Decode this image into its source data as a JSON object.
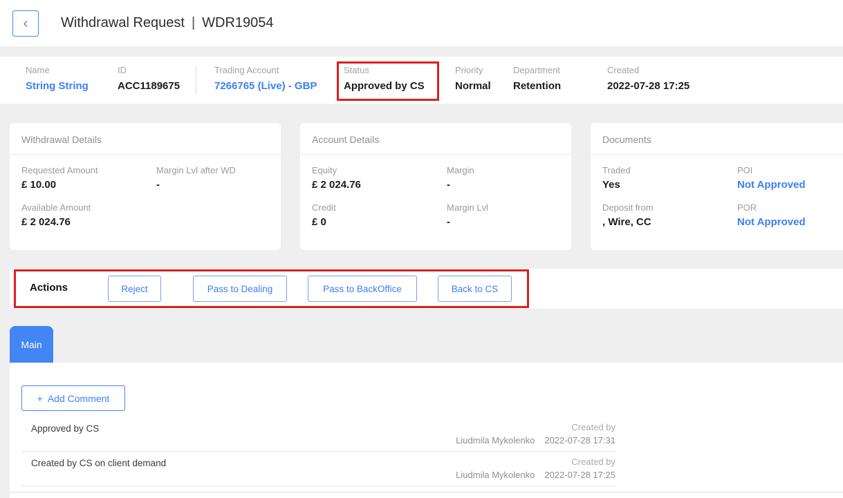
{
  "header": {
    "back_glyph": "‹",
    "title": "Withdrawal Request",
    "separator": "|",
    "request_id": "WDR19054"
  },
  "info_bar": {
    "fields": [
      {
        "label": "Name",
        "value": "String String"
      },
      {
        "label": "ID",
        "value": "ACC1189675"
      },
      {
        "label": "Trading Account",
        "value": "7266765 (Live) - GBP"
      },
      {
        "label": "Status",
        "value": "Approved by CS"
      },
      {
        "label": "Priority",
        "value": "Normal"
      },
      {
        "label": "Department",
        "value": "Retention"
      },
      {
        "label": "Created",
        "value": "2022-07-28 17:25"
      }
    ]
  },
  "cards": [
    {
      "title": "Withdrawal Details",
      "fields": [
        {
          "label": "Requested Amount",
          "value": "£ 10.00"
        },
        {
          "label": "Margin Lvl after WD",
          "value": "-"
        },
        {
          "label": "Available Amount",
          "value": "£ 2 024.76"
        }
      ]
    },
    {
      "title": "Account Details",
      "fields": [
        {
          "label": "Equity",
          "value": "£ 2 024.76"
        },
        {
          "label": "Margin",
          "value": "-"
        },
        {
          "label": "Credit",
          "value": "£ 0"
        },
        {
          "label": "Margin Lvl",
          "value": "-"
        }
      ]
    },
    {
      "title": "Documents",
      "fields": [
        {
          "label": "Traded",
          "value": "Yes"
        },
        {
          "label": "POI",
          "value": "Not Approved"
        },
        {
          "label": "Deposit from",
          "value": ", Wire, CC"
        },
        {
          "label": "POR",
          "value": "Not Approved"
        }
      ]
    }
  ],
  "actions": {
    "label": "Actions",
    "buttons": [
      {
        "label": "Reject"
      },
      {
        "label": "Pass to Dealing"
      },
      {
        "label": "Pass to BackOffice"
      },
      {
        "label": "Back to CS"
      }
    ]
  },
  "tabs": [
    {
      "label": "Main"
    }
  ],
  "comments": {
    "add_button": {
      "icon": "+",
      "label": "Add Comment"
    },
    "items": [
      {
        "text": "Approved by CS",
        "meta_label": "Created by",
        "author": "Liudmila Mykolenko",
        "datetime": "2022-07-28 17:31"
      },
      {
        "text": "Created by CS on client demand",
        "meta_label": "Created by",
        "author": "Liudmila Mykolenko",
        "datetime": "2022-07-28 17:25"
      }
    ]
  },
  "colors": {
    "accent_blue": "#4285f4",
    "link_blue": "#3d7ff3",
    "annotation_red": "#e01e1e",
    "label_gray": "#9b9b9b",
    "value_dark": "#1c1c1c",
    "page_background": "#efefef"
  }
}
